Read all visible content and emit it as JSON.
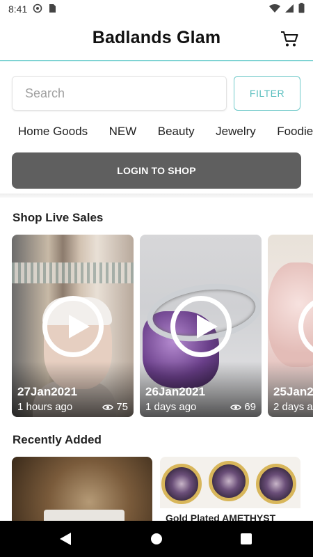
{
  "status_bar": {
    "time": "8:41"
  },
  "header": {
    "title": "Badlands Glam"
  },
  "search": {
    "placeholder": "Search",
    "value": "",
    "filter_label": "FILTER"
  },
  "categories": [
    "Home Goods",
    "NEW",
    "Beauty",
    "Jewelry",
    "Foodie"
  ],
  "login_button": "LOGIN TO SHOP",
  "live_sales": {
    "title": "Shop Live Sales",
    "cards": [
      {
        "date": "27Jan2021",
        "ago": "1 hours ago",
        "views": "75"
      },
      {
        "date": "26Jan2021",
        "ago": "1 days ago",
        "views": "69"
      },
      {
        "date": "25Jan2",
        "ago": "2 days a",
        "views": ""
      }
    ]
  },
  "recently_added": {
    "title": "Recently Added",
    "items": [
      {
        "caption": ""
      },
      {
        "caption": "Gold Plated AMETHYST"
      }
    ]
  },
  "colors": {
    "accent": "#5bbfbf",
    "header_border": "#7fd3d3",
    "login_bg": "#5f5f5f"
  }
}
